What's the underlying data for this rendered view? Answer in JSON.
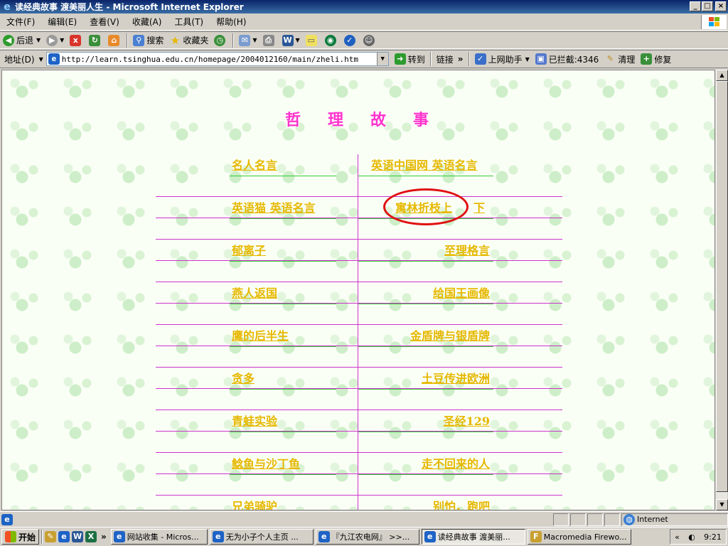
{
  "window": {
    "title": "读经典故事 渡美丽人生 - Microsoft Internet Explorer",
    "min_label": "_",
    "max_label": "□",
    "close_label": "×"
  },
  "menu": [
    "文件(F)",
    "编辑(E)",
    "查看(V)",
    "收藏(A)",
    "工具(T)",
    "帮助(H)"
  ],
  "toolbar": {
    "back": "后退",
    "search": "搜索",
    "favorites": "收藏夹"
  },
  "address": {
    "label": "地址(D)",
    "url": "http://learn.tsinghua.edu.cn/homepage/2004012160/main/zheli.htm",
    "go": "转到",
    "links": "链接",
    "helper": "上网助手",
    "blocked": "已拦截:4346",
    "clean": "清理",
    "repair": "修复"
  },
  "page": {
    "title": "哲理故事",
    "rows": [
      {
        "left": "名人名言",
        "right": "英语中国网 英语名言"
      },
      {
        "left": "英语猫 英语名言",
        "right": "寓林折枝上",
        "right_extra": "下"
      },
      {
        "left": "郁离子",
        "right": "至理格言"
      },
      {
        "left": "燕人返国",
        "right": "给国王画像"
      },
      {
        "left": "鹰的后半生",
        "right": "金盾牌与银盾牌"
      },
      {
        "left": "贪多",
        "right": "土豆传进欧洲"
      },
      {
        "left": "青蛙实验",
        "right": "圣经129"
      },
      {
        "left": "鲶鱼与沙丁鱼",
        "right": "走不回来的人"
      },
      {
        "left": "兄弟骑驴",
        "right": "别怕，跑吧"
      }
    ],
    "line_colors": {
      "magenta": "#cc33cc",
      "green": "#33cc33"
    },
    "link_color": "#e6b800"
  },
  "status": {
    "zone": "Internet"
  },
  "taskbar": {
    "start": "开始",
    "tasks": [
      "网站收集 - Micros...",
      "无为小子个人主页 ...",
      "『九江农电网』 >>...",
      "读经典故事 渡美丽...",
      "Macromedia Firewo..."
    ],
    "clock": "9:21"
  }
}
